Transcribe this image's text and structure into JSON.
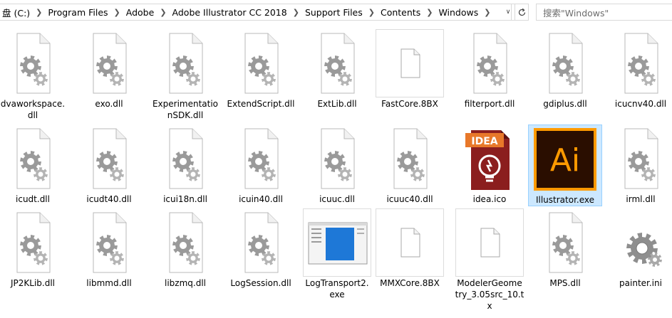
{
  "breadcrumb": {
    "items": [
      "盘 (C:)",
      "Program Files",
      "Adobe",
      "Adobe Illustrator CC 2018",
      "Support Files",
      "Contents",
      "Windows"
    ]
  },
  "search": {
    "placeholder": "搜索\"Windows\""
  },
  "files": [
    {
      "name": "dvaworkspace.\ndll",
      "icon": "dll-file-icon"
    },
    {
      "name": "exo.dll",
      "icon": "dll-file-icon"
    },
    {
      "name": "Experimentatio\nnSDK.dll",
      "icon": "dll-file-icon"
    },
    {
      "name": "ExtendScript.dll",
      "icon": "dll-file-icon"
    },
    {
      "name": "ExtLib.dll",
      "icon": "dll-file-icon"
    },
    {
      "name": "FastCore.8BX",
      "icon": "blank-file-icon"
    },
    {
      "name": "filterport.dll",
      "icon": "dll-file-icon"
    },
    {
      "name": "gdiplus.dll",
      "icon": "dll-file-icon"
    },
    {
      "name": "icucnv40.dll",
      "icon": "dll-file-icon"
    },
    {
      "name": "icudt.dll",
      "icon": "dll-file-icon"
    },
    {
      "name": "icudt40.dll",
      "icon": "dll-file-icon"
    },
    {
      "name": "icui18n.dll",
      "icon": "dll-file-icon"
    },
    {
      "name": "icuin40.dll",
      "icon": "dll-file-icon"
    },
    {
      "name": "icuuc.dll",
      "icon": "dll-file-icon"
    },
    {
      "name": "icuuc40.dll",
      "icon": "dll-file-icon"
    },
    {
      "name": "idea.ico",
      "icon": "idea-ico-icon",
      "badge": "IDEA"
    },
    {
      "name": "Illustrator.exe",
      "icon": "illustrator-app-icon",
      "badge": "Ai",
      "selected": true
    },
    {
      "name": "irml.dll",
      "icon": "dll-file-icon"
    },
    {
      "name": "JP2KLib.dll",
      "icon": "dll-file-icon"
    },
    {
      "name": "libmmd.dll",
      "icon": "dll-file-icon"
    },
    {
      "name": "libzmq.dll",
      "icon": "dll-file-icon"
    },
    {
      "name": "LogSession.dll",
      "icon": "dll-file-icon"
    },
    {
      "name": "LogTransport2.\nexe",
      "icon": "window-app-icon"
    },
    {
      "name": "MMXCore.8BX",
      "icon": "blank-file-icon"
    },
    {
      "name": "ModelerGeome\ntry_3.05src_10.t\nx",
      "icon": "blank-file-icon"
    },
    {
      "name": "MPS.dll",
      "icon": "dll-file-icon"
    },
    {
      "name": "painter.ini",
      "icon": "settings-gear-icon"
    }
  ],
  "colors": {
    "selection_bg": "#cce8ff",
    "selection_border": "#99d1ff",
    "gear": "#9a9a9a",
    "ai_bg": "#2a0e00",
    "ai_accent": "#ff9a00",
    "idea_red": "#8b1e1e",
    "idea_orange": "#e8782a"
  }
}
